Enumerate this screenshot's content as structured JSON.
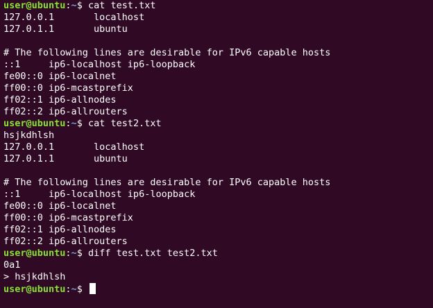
{
  "prompt": {
    "user_host": "user@ubuntu",
    "colon": ":",
    "path": "~",
    "symbol": "$ "
  },
  "lines": [
    {
      "type": "prompt",
      "command": "cat test.txt"
    },
    {
      "type": "output",
      "text": "127.0.0.1       localhost"
    },
    {
      "type": "output",
      "text": "127.0.1.1       ubuntu"
    },
    {
      "type": "output",
      "text": ""
    },
    {
      "type": "output",
      "text": "# The following lines are desirable for IPv6 capable hosts"
    },
    {
      "type": "output",
      "text": "::1     ip6-localhost ip6-loopback"
    },
    {
      "type": "output",
      "text": "fe00::0 ip6-localnet"
    },
    {
      "type": "output",
      "text": "ff00::0 ip6-mcastprefix"
    },
    {
      "type": "output",
      "text": "ff02::1 ip6-allnodes"
    },
    {
      "type": "output",
      "text": "ff02::2 ip6-allrouters"
    },
    {
      "type": "prompt",
      "command": "cat test2.txt"
    },
    {
      "type": "output",
      "text": "hsjkdhlsh"
    },
    {
      "type": "output",
      "text": "127.0.0.1       localhost"
    },
    {
      "type": "output",
      "text": "127.0.1.1       ubuntu"
    },
    {
      "type": "output",
      "text": ""
    },
    {
      "type": "output",
      "text": "# The following lines are desirable for IPv6 capable hosts"
    },
    {
      "type": "output",
      "text": "::1     ip6-localhost ip6-loopback"
    },
    {
      "type": "output",
      "text": "fe00::0 ip6-localnet"
    },
    {
      "type": "output",
      "text": "ff00::0 ip6-mcastprefix"
    },
    {
      "type": "output",
      "text": "ff02::1 ip6-allnodes"
    },
    {
      "type": "output",
      "text": "ff02::2 ip6-allrouters"
    },
    {
      "type": "prompt",
      "command": "diff test.txt test2.txt"
    },
    {
      "type": "output",
      "text": "0a1"
    },
    {
      "type": "output",
      "text": "> hsjkdhlsh"
    },
    {
      "type": "prompt",
      "command": "",
      "cursor": true
    }
  ],
  "colors": {
    "background": "#300a24",
    "user_host": "#8ae234",
    "path": "#729fcf",
    "text": "#ffffff"
  }
}
